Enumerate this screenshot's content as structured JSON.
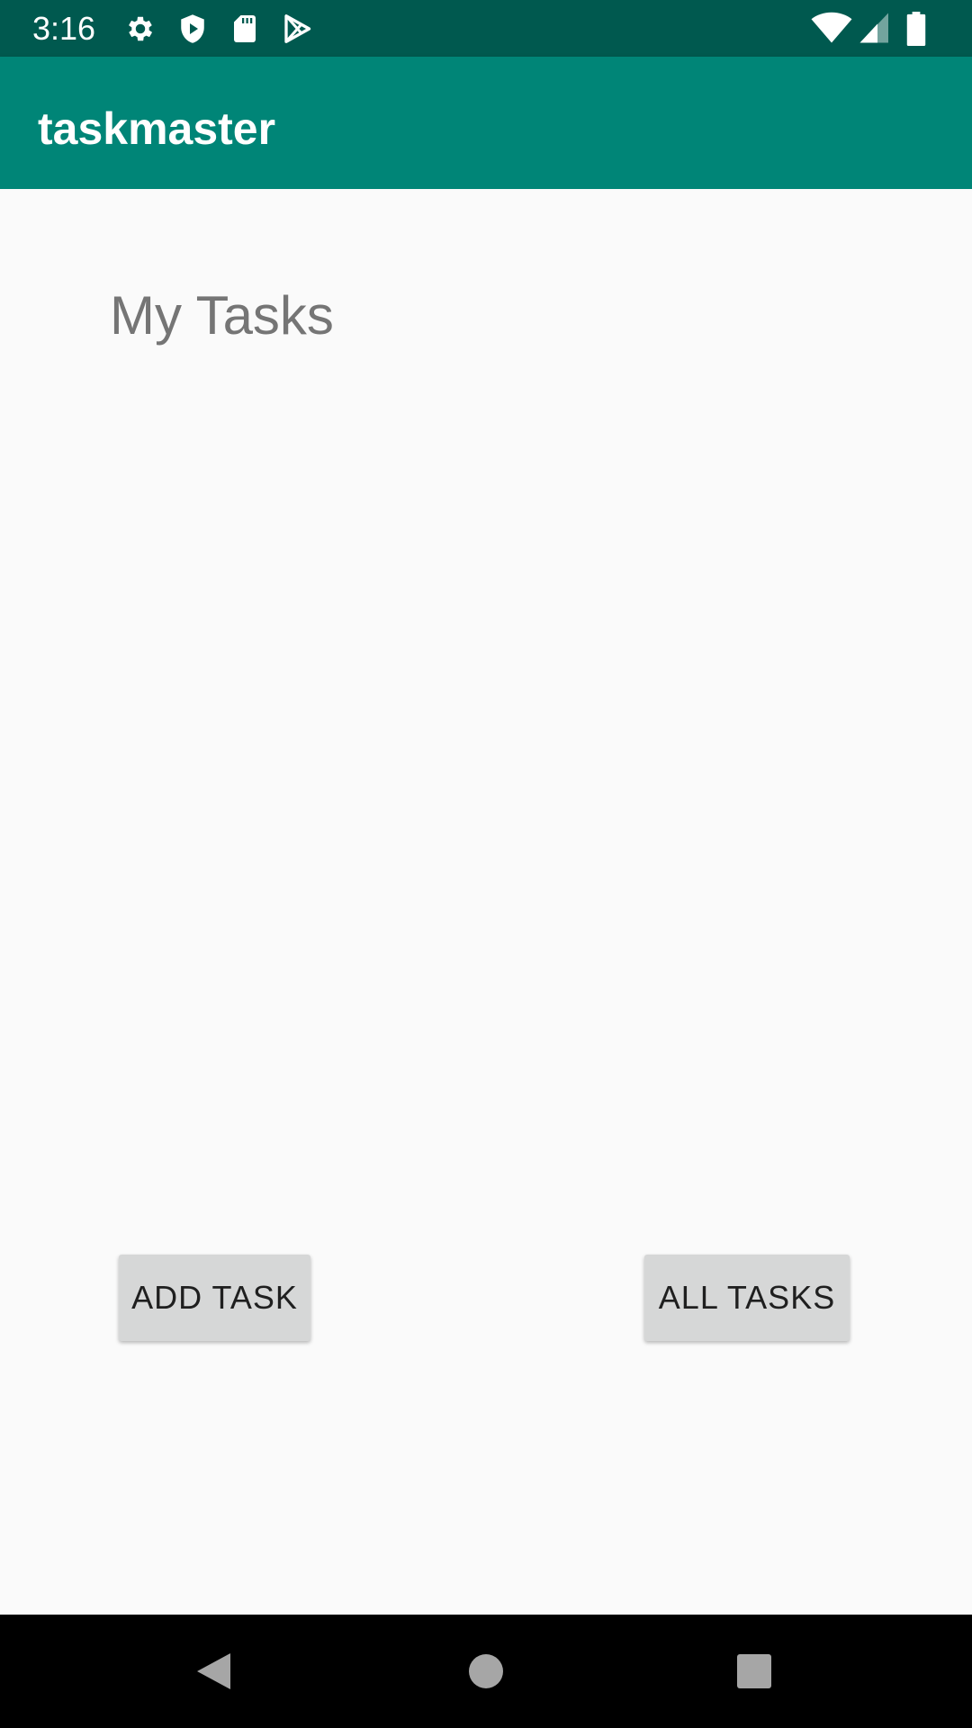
{
  "status_bar": {
    "time": "3:16",
    "background": "#00594f",
    "icons_left": [
      "settings-icon",
      "shield-icon",
      "sd-card-icon",
      "play-store-icon"
    ],
    "icons_right": [
      "wifi-icon",
      "cell-signal-icon",
      "battery-icon"
    ]
  },
  "app_bar": {
    "title": "taskmaster",
    "color": "#008577"
  },
  "main": {
    "heading": "My Tasks",
    "add_task_label": "ADD TASK",
    "all_tasks_label": "ALL TASKS"
  },
  "nav_bar": {
    "buttons": [
      "back-icon",
      "home-icon",
      "recents-icon"
    ]
  }
}
